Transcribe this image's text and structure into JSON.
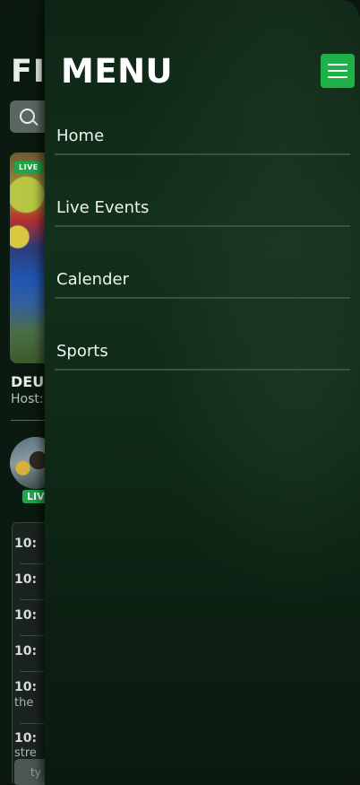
{
  "background": {
    "page_title_fragment": "FI",
    "live_badge": "LIVE",
    "card_title_fragment": "DEU",
    "card_host_fragment": "Host:",
    "avatar_live_badge": "LIVE",
    "chat_rows": [
      "10:",
      "10:",
      "10:",
      "10:",
      "10:",
      "10:"
    ],
    "chat_subtexts": [
      "the",
      "stre"
    ],
    "chat_input_placeholder": "ty"
  },
  "menu": {
    "title": "MENU",
    "toggle_icon": "hamburger-icon",
    "items": [
      {
        "label": "Home"
      },
      {
        "label": "Live Events"
      },
      {
        "label": "Calender"
      },
      {
        "label": "Sports"
      }
    ]
  },
  "colors": {
    "accent_green": "#1db148",
    "live_badge_green": "#1da64a",
    "menu_text": "#eef3ef",
    "divider": "#3b5141"
  }
}
